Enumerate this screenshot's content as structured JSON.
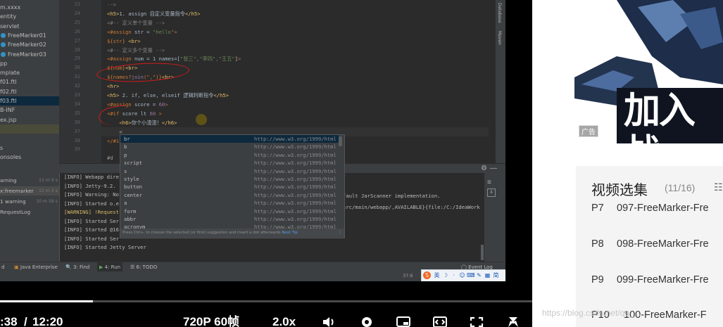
{
  "project_tree": [
    {
      "label": "m.xxxx",
      "icon": null
    },
    {
      "label": "entity",
      "icon": null
    },
    {
      "label": "servlet",
      "icon": null
    },
    {
      "label": "FreeMarker01",
      "icon": "class-icon"
    },
    {
      "label": "FreeMarker02",
      "icon": "class-icon"
    },
    {
      "label": "FreeMarker03",
      "icon": "class-icon"
    },
    {
      "label": "pp",
      "icon": null
    },
    {
      "label": "mplate",
      "icon": null
    },
    {
      "label": "f01.ftl",
      "icon": null
    },
    {
      "label": "f02.ftl",
      "icon": null
    },
    {
      "label": "f03.ftl",
      "icon": null
    },
    {
      "label": "B-INF",
      "icon": null
    },
    {
      "label": "ex.jsp",
      "icon": null
    },
    {
      "label": "",
      "icon": null
    },
    {
      "label": "",
      "icon": null
    },
    {
      "label": "s",
      "icon": null
    },
    {
      "label": "onsoles",
      "icon": null
    }
  ],
  "editor": {
    "line_numbers": [
      "23",
      "24",
      "25",
      "26",
      "27",
      "28",
      "29",
      "30",
      "31",
      "32",
      "33",
      "34",
      "35",
      "36",
      "37",
      "38",
      "39"
    ],
    "lines": [
      [
        {
          "c": "cm",
          "t": "-->"
        }
      ],
      [
        {
          "c": "tag",
          "t": "<h5>"
        },
        {
          "c": "txt",
          "t": "1. assign 自定义变量指令"
        },
        {
          "c": "tag",
          "t": "</h5>"
        }
      ],
      [
        {
          "c": "cm",
          "t": "<#-- 定义单个变量 -->"
        }
      ],
      [
        {
          "c": "dir",
          "t": "<#assign "
        },
        {
          "c": "txt",
          "t": "str = "
        },
        {
          "c": "str",
          "t": "\"hello\""
        },
        {
          "c": "dir",
          "t": ">"
        }
      ],
      [
        {
          "c": "dir",
          "t": "${str}"
        },
        {
          "c": "tag",
          "t": " <br>"
        }
      ],
      [
        {
          "c": "cm",
          "t": "<#-- 定义多个变量 -->"
        }
      ],
      [
        {
          "c": "dir",
          "t": "<#assign "
        },
        {
          "c": "txt",
          "t": "num = 1 names=["
        },
        {
          "c": "str",
          "t": "\"张三\",\"李四\",\"王五\""
        },
        {
          "c": "txt",
          "t": "]"
        },
        {
          "c": "dir",
          "t": ">"
        }
      ],
      [
        {
          "c": "dir",
          "t": "${num}"
        },
        {
          "c": "tag",
          "t": "<br>"
        }
      ],
      [
        {
          "c": "dir",
          "t": "${names?"
        },
        {
          "c": "kw",
          "t": "join"
        },
        {
          "c": "dir",
          "t": "(\",\")}"
        },
        {
          "c": "tag",
          "t": "<br>"
        }
      ],
      [
        {
          "c": "tag",
          "t": "<hr>"
        }
      ],
      [
        {
          "c": "tag",
          "t": "<h5>"
        },
        {
          "c": "txt",
          "t": " 2. if, else, elseif 逻辑判断指令"
        },
        {
          "c": "tag",
          "t": "</h5>"
        }
      ],
      [
        {
          "c": "dir",
          "t": "<#assign "
        },
        {
          "c": "txt",
          "t": "score = "
        },
        {
          "c": "kw",
          "t": "60"
        },
        {
          "c": "dir",
          "t": ">"
        }
      ],
      [
        {
          "c": "dir",
          "t": "<#if "
        },
        {
          "c": "txt",
          "t": "score lt "
        },
        {
          "c": "kw",
          "t": "60"
        },
        {
          "c": "dir",
          "t": " >"
        }
      ],
      [
        {
          "c": "tag",
          "t": "    <h6>"
        },
        {
          "c": "txt",
          "t": "你个小渣渣！"
        },
        {
          "c": "tag",
          "t": "</h6>"
        }
      ],
      [
        {
          "c": "txt",
          "t": "    <"
        }
      ],
      [
        {
          "c": "dir",
          "t": "</#i"
        }
      ],
      [
        {
          "c": "txt",
          "t": ""
        }
      ]
    ],
    "breadcrumb": "#d"
  },
  "completion": {
    "items": [
      {
        "name": "br",
        "url": "http://www.w3.org/1999/html"
      },
      {
        "name": "b",
        "url": "http://www.w3.org/1999/html"
      },
      {
        "name": "p",
        "url": "http://www.w3.org/1999/html"
      },
      {
        "name": "script",
        "url": "http://www.w3.org/1999/html"
      },
      {
        "name": "s",
        "url": "http://www.w3.org/1999/html"
      },
      {
        "name": "style",
        "url": "http://www.w3.org/1999/html"
      },
      {
        "name": "button",
        "url": "http://www.w3.org/1999/html"
      },
      {
        "name": "center",
        "url": "http://www.w3.org/1999/html"
      },
      {
        "name": "a",
        "url": "http://www.w3.org/1999/html"
      },
      {
        "name": "form",
        "url": "http://www.w3.org/1999/html"
      },
      {
        "name": "abbr",
        "url": "http://www.w3.org/1999/html"
      },
      {
        "name": "acronym",
        "url": "http://www.w3.org/1999/html"
      }
    ],
    "hint": "Press Ctrl+. to choose the selected (or first) suggestion and insert a dot afterwards",
    "hint_link": "Next Tip"
  },
  "run_tree": [
    {
      "label": "arning",
      "time": "11 m 9 s"
    },
    {
      "label": "x:freemarker",
      "time": "11 m 3 s"
    },
    {
      "label": "1 warning",
      "time": "10 m 58 s"
    },
    {
      "label": "RequestLog",
      "time": ""
    }
  ],
  "console": [
    "[INFO] Webapp dire",
    "[INFO] Jetty-9.2.",
    "[INFO] Warning: No",
    "[INFO] Started o.e",
    "[WARNING] !Request",
    "[INFO] Started Ser",
    "[INFO] Started @16",
    "[INFO] Started Ser",
    "[INFO] Started Jetty Server"
  ],
  "console_overflow": [
    "fault JarScanner implementation.",
    "src/main/webapp/,AVAILABLE}{file:/C:/IdeaWork"
  ],
  "tool_tabs": [
    "d",
    "Java Enterprise",
    "3: Find",
    "4: Run",
    "6: TODO"
  ],
  "event_log": "Event Log",
  "status_position": "37:6",
  "ime_label": "英",
  "side_labels": [
    "Database",
    "Maven"
  ],
  "video": {
    "time_current": ":38",
    "time_separator": "/",
    "time_total": "12:20",
    "quality": "720P 60帧",
    "speed": "2.0x",
    "progress": 0.175
  },
  "playlist": {
    "title": "视频选集",
    "count": "(11/16)",
    "items": [
      {
        "num": "P7",
        "title": "097-FreeMarker-Fre"
      },
      {
        "num": "P8",
        "title": "098-FreeMarker-Fre"
      },
      {
        "num": "P9",
        "title": "099-FreeMarker-Fre"
      },
      {
        "num": "P10",
        "title": "100-FreeMarker-F"
      }
    ]
  },
  "watermark": "https://blog.csdn.net/qq_...",
  "thumb_text": "加入战",
  "thumb_badge": "广告",
  "colors": {
    "accent_blue": "#0d293e",
    "annotation_red": "#d81b1b",
    "ide_bg": "#2b2b2b"
  }
}
